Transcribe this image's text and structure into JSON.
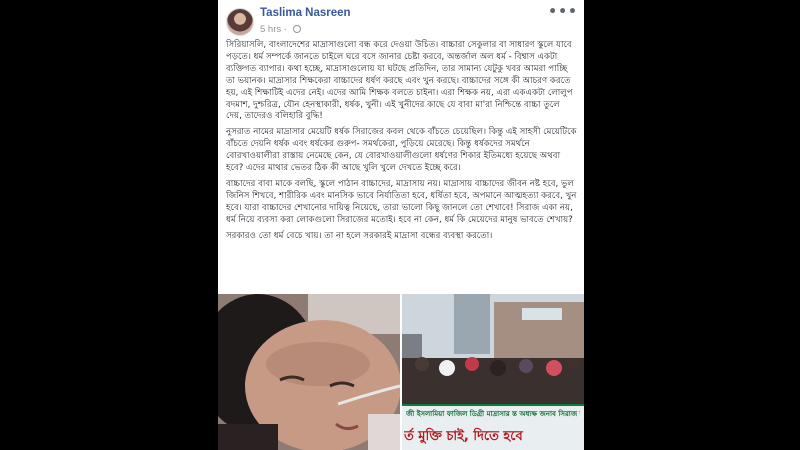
{
  "post": {
    "author": "Taslima Nasreen",
    "time": "5 hrs · ",
    "paragraphs": [
      "সিরিয়াসলি, বাংলাদেশের মাদ্রাসাগুলো বন্ধ করে দেওয়া উচিত। বাচ্চারা সেকুলার বা সাধারণ স্কুলে যাবে পড়তে। ধর্ম সম্পর্কে জানতে চাইলে ঘরে বসে জানার চেষ্টা করবে, অন্তর্জাল অল ধর্ম - বিশ্বাস একটা ব্যক্তিগত ব্যাপার। কথা হচ্ছে, মাদ্রাসাগুলোয় যা ঘটছে প্রতিদিন, তার সামান্য যেটুকু খবর আমরা পাচ্ছি তা ভয়ানক। মাদ্রাসার শিক্ষকেরা বাচ্চাদের ধর্ষণ করছে এবং খুন করছে। বাচ্চাদের সঙ্গে কী আচরণ করতে হয়, এই শিক্ষাটিই এদের নেই। এদের আমি শিক্ষক বলতে চাইনা। এরা শিক্ষক নয়, এরা একএকটা লোলুপ বদমাশ, দুশ্চরিত্র, যৌন হেনস্থাকারী, ধর্ষক, খুনী। এই খুনীদের কাছে যে বাবা মা'রা নিশ্চিন্তে বাচ্চা তুলে দেয়, তাদেরও বলিহারি বুদ্ধি!",
      "নুসরাত নামের মাদ্রাসার মেয়েটি ধর্ষক সিরাজের কবল থেকে বাঁচতে চেয়েছিল। কিন্তু এই সাহসী মেয়েটিকে বাঁচতে দেয়নি ধর্ষক এবং ধর্ষকের গুরুপ- সমর্থকেরা, পুড়িয়ে মেরেছে। কিন্তু ধর্ষকদের সমর্থনে বোরখাওয়ালীরা রাস্তায় নেমেছে কেন, যে বোরখাওয়ালীগুলো ধর্ষণের শিকার ইতিমধ্যে হয়েছে অথবা হবে? এদের মাথার ভেতর ঠিক কী আছে খুলি খুলে দেখতে ইচ্ছে করে।",
      "বাচ্চাদের বাবা মাকে বলছি, স্কুলে পাঠান বাচ্চাদের, মাদ্রাসায় নয়। মাদ্রাসায় বাচ্চাদের জীবন নষ্ট হবে, ভুল জিনিস শিখবে, শারীরিক এবং মানসিক ভাবে নির্যাতিতা হবে, ধর্ষিতা হবে, অপমানে আত্মহত্যা করবে, খুন হবে। যারা বাচ্চাদের শেখানোর দায়িত্ব নিয়েছে, তারা ভালো কিছু জানলে তো শেখাবে! সিরাজ একা নয়, ধর্ম নিয়ে ব্যবসা করা লোকগুলো সিরাজের মতোই। হবে না কেন, ধর্ম কি মেয়েদের মানুষ ভাবতে শেখায়?",
      "সরকারও তো ধর্ম বেচে খায়। তা না হলে সরকারই মাদ্রাসা বন্ধের ব্যবস্থা করতো।"
    ]
  },
  "photo_banner": {
    "top_text": "জী ইসলামিয়া ফাজিল ডিগ্রী মাদ্রাসার ন্ত অধ্যক্ষ জনাব সিরাজ উদ্দৌলার",
    "big_text": "র্ত মুক্তি চাই, দিতে হবে"
  }
}
